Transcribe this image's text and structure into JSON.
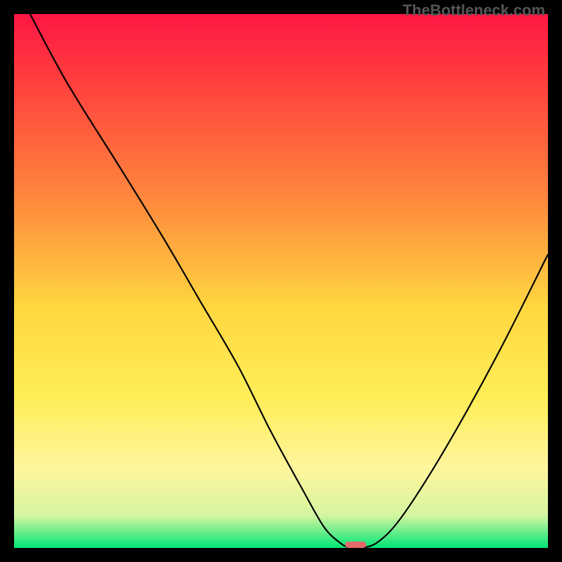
{
  "watermark": "TheBottleneck.com",
  "colors": {
    "gradient_top": "#ff1744",
    "gradient_upper": "#ff3d3d",
    "gradient_mid_upper": "#ff8a3d",
    "gradient_mid": "#ffd740",
    "gradient_lower_mid": "#ffee58",
    "gradient_lower": "#fff59d",
    "gradient_near_bottom": "#d4f5a0",
    "gradient_bottom": "#00e676",
    "curve": "#000000",
    "marker": "#e26a6a",
    "frame": "#000000"
  },
  "chart_data": {
    "type": "line",
    "title": "",
    "xlabel": "",
    "ylabel": "",
    "xlim": [
      0,
      100
    ],
    "ylim": [
      0,
      100
    ],
    "series": [
      {
        "name": "bottleneck-curve",
        "x": [
          3,
          10,
          20,
          28,
          35,
          42,
          48,
          54,
          58,
          61,
          63,
          65,
          68,
          72,
          78,
          85,
          92,
          100
        ],
        "y": [
          100,
          87,
          71,
          58,
          46,
          34,
          22,
          11,
          4,
          1,
          0,
          0,
          1,
          5,
          14,
          26,
          39,
          55
        ]
      }
    ],
    "marker": {
      "x": 64,
      "y": 0,
      "width": 4,
      "height": 1.2,
      "shape": "rounded-rect"
    },
    "annotations": []
  }
}
